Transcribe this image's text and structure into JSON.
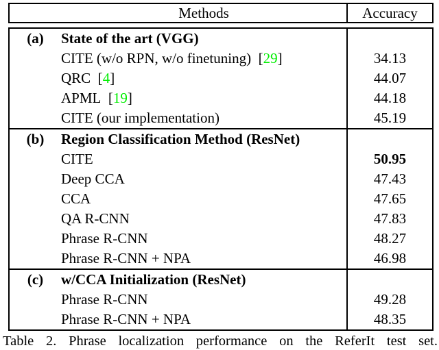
{
  "table": {
    "columns": [
      "",
      "Methods",
      "Accuracy"
    ],
    "header": {
      "label": "",
      "methods": "Methods",
      "accuracy": "Accuracy"
    },
    "sections": [
      {
        "label": "(a)",
        "title": "State of the art (VGG)",
        "title_accuracy": "",
        "rows": [
          {
            "method": "CITE (w/o RPN, w/o finetuning)",
            "ref": "29",
            "accuracy": "34.13",
            "best": false
          },
          {
            "method": "QRC",
            "ref": "4",
            "accuracy": "44.07",
            "best": false
          },
          {
            "method": "APML",
            "ref": "19",
            "accuracy": "44.18",
            "best": false
          },
          {
            "method": "CITE (our implementation)",
            "ref": "",
            "accuracy": "45.19",
            "best": false
          }
        ]
      },
      {
        "label": "(b)",
        "title": "Region Classification Method (ResNet)",
        "title_accuracy": "",
        "rows": [
          {
            "method": "CITE",
            "ref": "",
            "accuracy": "50.95",
            "best": true
          },
          {
            "method": "Deep CCA",
            "ref": "",
            "accuracy": "47.43",
            "best": false
          },
          {
            "method": "CCA",
            "ref": "",
            "accuracy": "47.65",
            "best": false
          },
          {
            "method": "QA R-CNN",
            "ref": "",
            "accuracy": "47.83",
            "best": false
          },
          {
            "method": "Phrase R-CNN",
            "ref": "",
            "accuracy": "48.27",
            "best": false
          },
          {
            "method": "Phrase R-CNN + NPA",
            "ref": "",
            "accuracy": "46.98",
            "best": false
          }
        ]
      },
      {
        "label": "(c)",
        "title": "w/CCA Initialization (ResNet)",
        "title_accuracy": "",
        "rows": [
          {
            "method": "Phrase R-CNN",
            "ref": "",
            "accuracy": "49.28",
            "best": false
          },
          {
            "method": "Phrase R-CNN + NPA",
            "ref": "",
            "accuracy": "48.35",
            "best": false
          }
        ]
      }
    ]
  },
  "caption": {
    "text": "Table 2. Phrase localization performance on the ReferIt test set."
  },
  "colors": {
    "citation_green": "#00ee00",
    "text": "#000000",
    "rule": "#000000",
    "background": "#ffffff"
  }
}
